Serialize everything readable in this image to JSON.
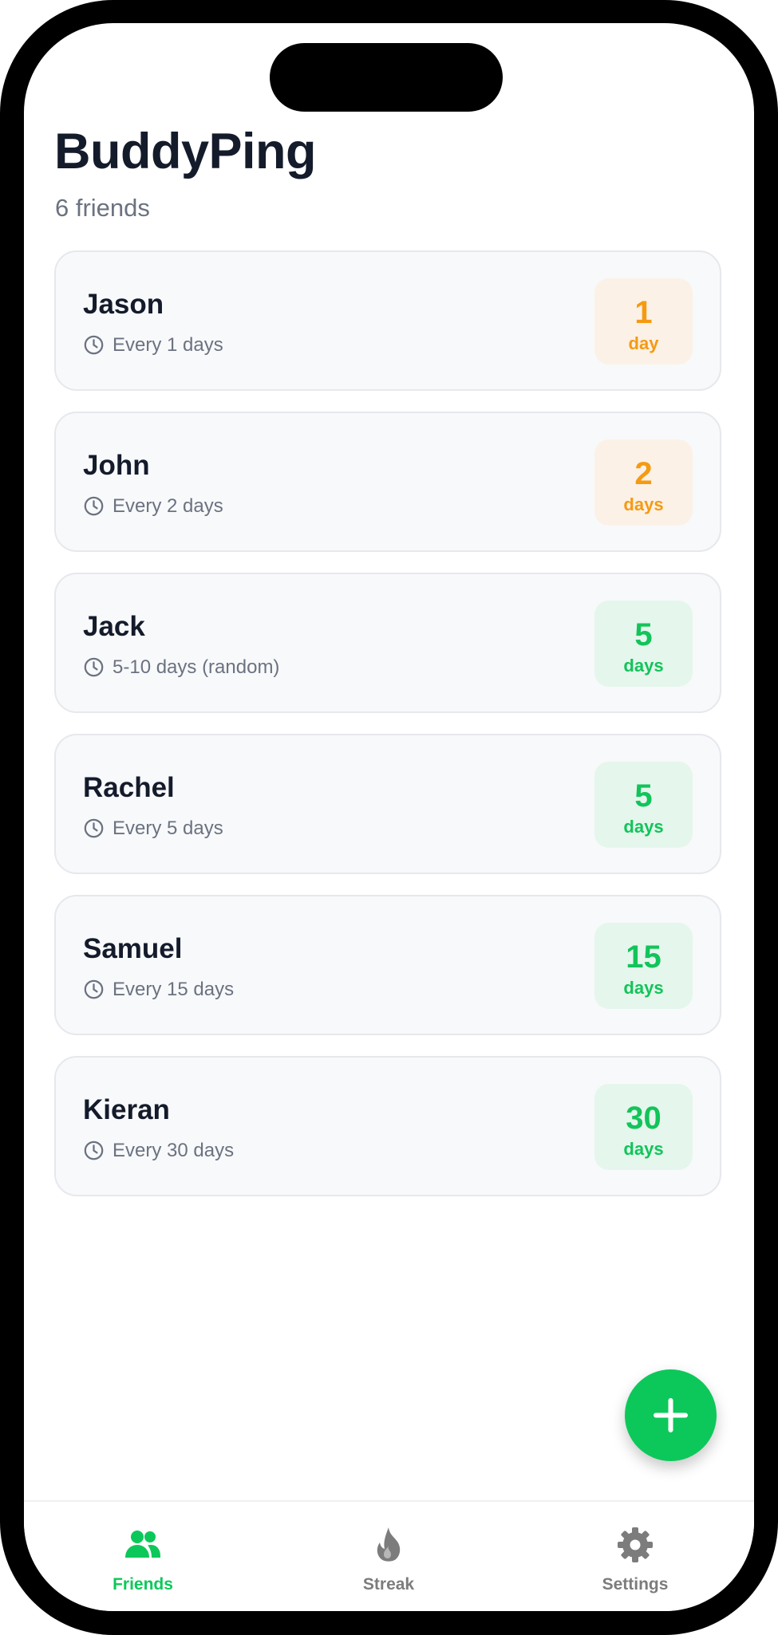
{
  "app": {
    "title": "BuddyPing",
    "subtitle": "6 friends"
  },
  "friends": [
    {
      "name": "Jason",
      "schedule": "Every 1 days",
      "count": "1",
      "unit": "day",
      "status": "orange"
    },
    {
      "name": "John",
      "schedule": "Every 2 days",
      "count": "2",
      "unit": "days",
      "status": "orange"
    },
    {
      "name": "Jack",
      "schedule": "5-10 days (random)",
      "count": "5",
      "unit": "days",
      "status": "green"
    },
    {
      "name": "Rachel",
      "schedule": "Every 5 days",
      "count": "5",
      "unit": "days",
      "status": "green"
    },
    {
      "name": "Samuel",
      "schedule": "Every 15 days",
      "count": "15",
      "unit": "days",
      "status": "green"
    },
    {
      "name": "Kieran",
      "schedule": "Every 30 days",
      "count": "30",
      "unit": "days",
      "status": "green"
    }
  ],
  "fab": {
    "icon": "plus-icon"
  },
  "tabs": [
    {
      "label": "Friends",
      "icon": "friends-icon",
      "active": true
    },
    {
      "label": "Streak",
      "icon": "flame-icon",
      "active": false
    },
    {
      "label": "Settings",
      "icon": "gear-icon",
      "active": false
    }
  ],
  "colors": {
    "accent": "#0cc85a",
    "warning": "#f59a13",
    "warning_bg": "#fbf1e6",
    "success_bg": "#e5f6ec",
    "title": "#141b2b",
    "muted": "#6b7280",
    "card_bg": "#f8f9fb",
    "inactive_tab": "#7c7c7c"
  }
}
